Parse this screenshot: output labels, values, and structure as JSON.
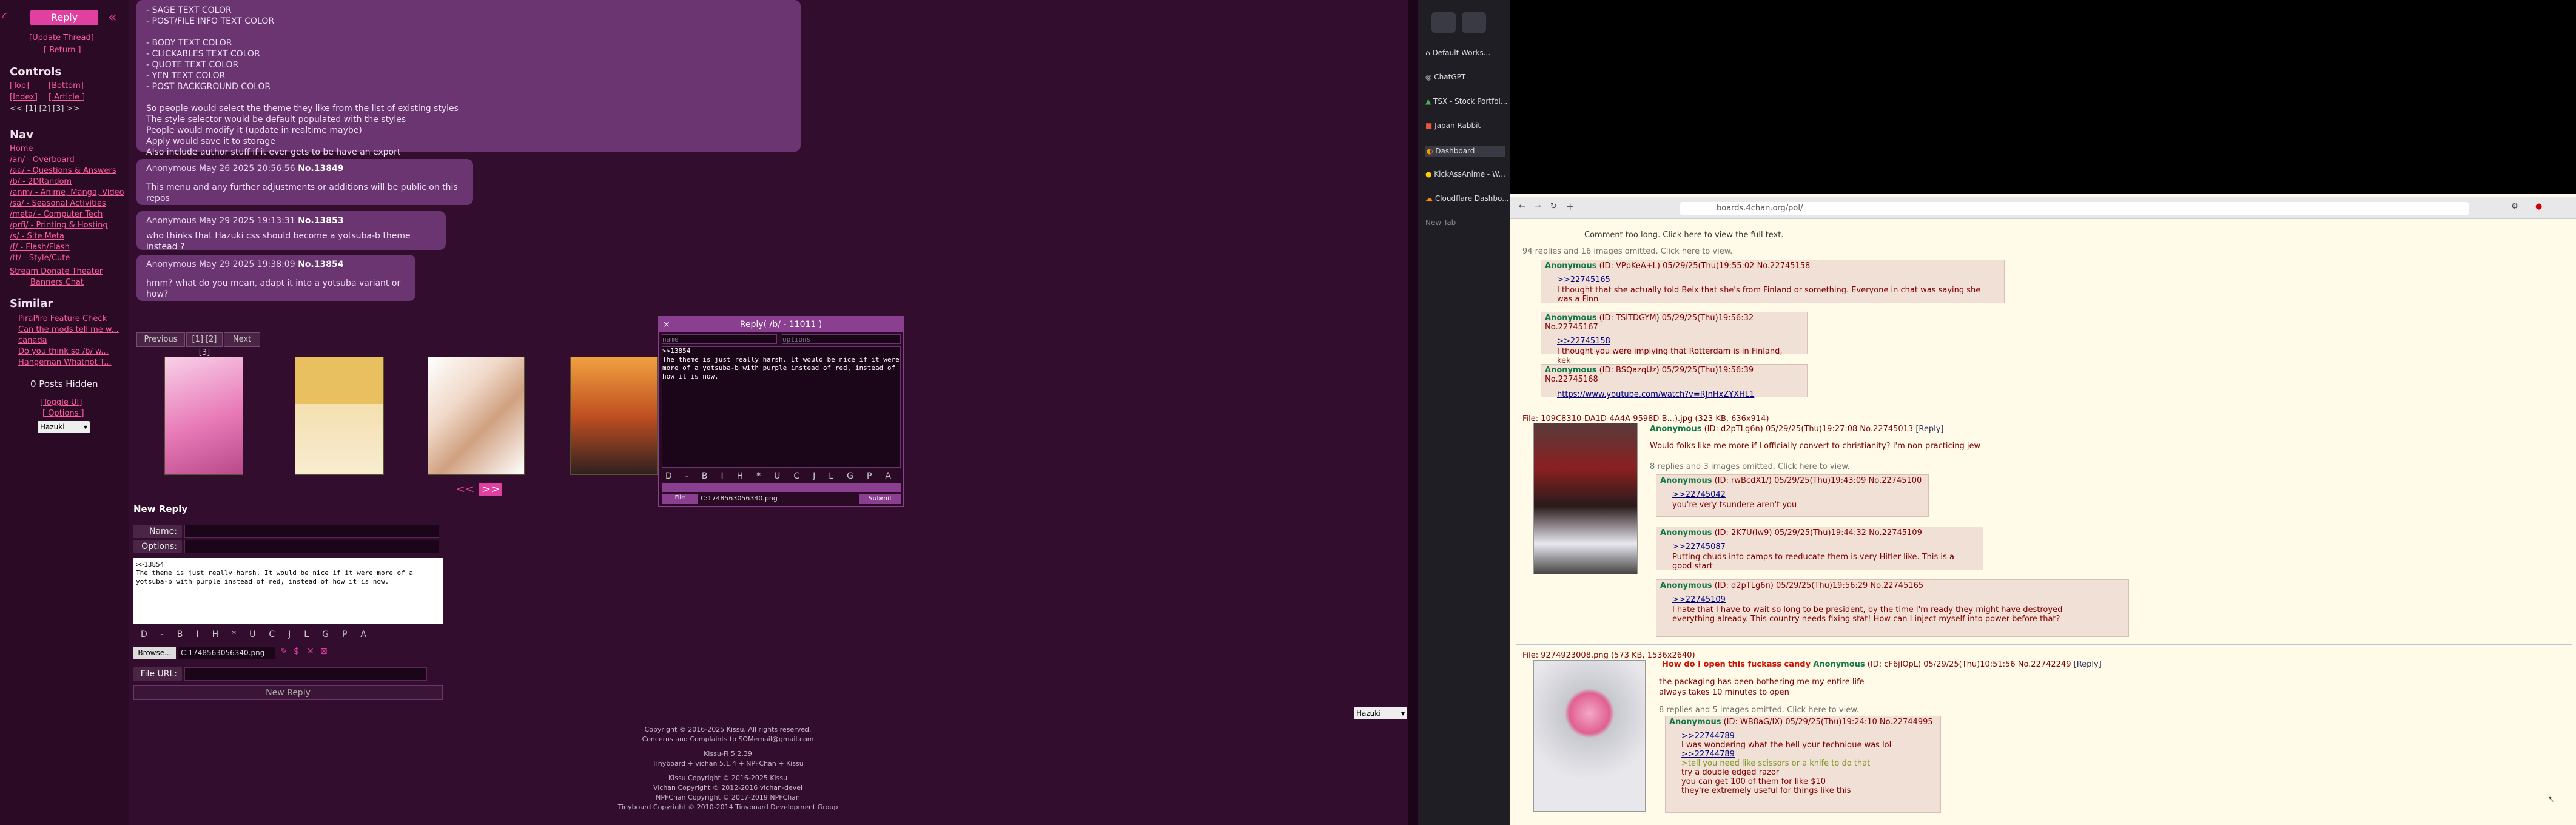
{
  "sidebar": {
    "reply_label": "Reply",
    "top_links": [
      "[Update Thread]",
      "[ Return ]"
    ],
    "controls_title": "Controls",
    "controls_links": [
      "[Top]",
      "[Bottom]",
      "[Index]",
      "[ Article ]",
      "<< [1] [2] [3] >>"
    ],
    "nav_title": "Nav",
    "nav_links": [
      "Home",
      "/an/ - Overboard",
      "/aa/ - Questions & Answers",
      "/b/ - 2DRandom",
      "/anm/ - Anime, Manga, Video",
      "/sa/ - Seasonal Activities",
      "/meta/ - Computer Tech",
      "/prfi/ - Printing & Hosting",
      "/s/ - Site Meta",
      "/f/ - Flash/Flash",
      "/tt/ - Style/Cute",
      "Stream  Donate  Theater",
      "Banners  Chat"
    ],
    "similar_title": "Similar",
    "similar_links": [
      "PiraPiro Feature Check",
      "Can the mods tell me w...",
      "canada",
      "Do you think so /b/ w...",
      "Hangeman Whatnot T..."
    ],
    "hidden_label": "0 Posts Hidden",
    "toggle_links": [
      "[Toggle UI]",
      "[ Options ]"
    ],
    "theme_select": "Hazuki"
  },
  "big_post": {
    "lines": "- SAGE TEXT COLOR\n- POST/FILE INFO TEXT COLOR\n\n- BODY TEXT COLOR\n- CLICKABLES TEXT COLOR\n- QUOTE TEXT COLOR\n- YEN TEXT COLOR\n- POST BACKGROUND COLOR\n\nSo people would select the theme they like from the list of existing styles\nThe style selector would be default populated with the styles\nPeople would modify it (update in realtime maybe)\nApply would save it to storage\nAlso include author stuff if it ever gets to be have an export"
  },
  "posts": [
    {
      "name": "Anonymous",
      "date": "May 26 2025 20:56:56",
      "no": "No.13849",
      "body": "This menu and any further adjustments or additions will be public on this repos"
    },
    {
      "name": "Anonymous",
      "date": "May 29 2025 19:13:31",
      "no": "No.13853",
      "body": "who thinks that Hazuki css should become a yotsuba-b theme instead ?"
    },
    {
      "name": "Anonymous",
      "date": "May 29 2025 19:38:09",
      "no": "No.13854",
      "body": "hmm? what do you mean, adapt it into a yotsuba variant or how?"
    }
  ],
  "pager": {
    "prev": "Previous",
    "pages": "[1] [2] [3]",
    "next": "Next"
  },
  "quick_reply": {
    "title": "Reply( /b/ - 11011 )",
    "name_ph": "name",
    "options_ph": "options",
    "body": ">>13854\nThe theme is just really harsh. It would be nice if it were more of a yotsuba-b with purple instead of red, instead of how it is now.",
    "fmt": [
      "D",
      "-",
      "B",
      "I",
      "H",
      "*",
      "U",
      "C",
      "J",
      "L",
      "G",
      "P",
      "A"
    ],
    "file": "C:1748563056340.png",
    "submit": "Submit"
  },
  "new_reply": {
    "title": "New Reply",
    "name_label": "Name:",
    "options_label": "Options:",
    "body": ">>13854\nThe theme is just really harsh. It would be nice if it were more of a yotsuba-b with purple instead of red, instead of how it is now.",
    "fmt": [
      "D",
      "-",
      "B",
      "I",
      "H",
      "*",
      "U",
      "C",
      "J",
      "L",
      "G",
      "P",
      "A"
    ],
    "browse": "Browse...",
    "file": "C:1748563056340.png",
    "fileurl_label": "File URL:",
    "submit": "New Reply"
  },
  "footer": {
    "lines": [
      "Copyright © 2016-2025 Kissu. All rights reserved.",
      "Concerns and Complaints to SOMemail@gmail.com",
      "",
      "Kissu-Fi 5.2.39",
      "Tinyboard + vichan 5.1.4 + NPFChan + Kissu",
      "",
      "Kissu Copyright © 2016-2025 Kissu",
      "Vichan Copyright © 2012-2016 vichan-devel",
      "NPFChan Copyright © 2017-2019 NPFChan",
      "Tinyboard Copyright © 2010-2014 Tinyboard Development Group"
    ],
    "theme_select": "Hazuki"
  },
  "tabs": [
    "Default Works...",
    "ChatGPT",
    "TSX - Stock Portfol...",
    "Japan Rabbit",
    "Dashboard",
    "KickAssAnime - W...",
    "Cloudflare Dashbo...",
    "New Tab"
  ],
  "browser": {
    "url": "boards.4chan.org/pol/"
  },
  "fc": {
    "top_note": "Comment too long. Click here to view the full text.",
    "omit1": "94 replies and 16 images omitted. Click here to view.",
    "r1": {
      "name": "Anonymous",
      "meta": "(ID: VPpKeA+L) 05/29/25(Thu)19:55:02 No.22745158",
      "q": ">>22745165",
      "text": "I thought that she actually told Beix that she's from Finland or something. Everyone in chat was saying she was a Finn"
    },
    "r2": {
      "name": "Anonymous",
      "meta": "(ID: TSITDGYM) 05/29/25(Thu)19:56:32 No.22745167",
      "q": ">>22745158",
      "text": "I thought you were implying that Rotterdam is in Finland, kek"
    },
    "r3": {
      "name": "Anonymous",
      "meta": "(ID: BSQazqUz) 05/29/25(Thu)19:56:39 No.22745168",
      "text": "https://www.youtube.com/watch?v=RJnHxZYXHL1"
    },
    "file1": "File: 109C8310-DA1D-4A4A-9598D-B...).jpg (323 KB, 636x914)",
    "op1": {
      "name": "Anonymous",
      "meta": "(ID: d2pTLg6n) 05/29/25(Thu)19:27:08 No.22745013",
      "reply": "[Reply]",
      "text": "Would folks like me more if I officially convert to christianity? I'm non-practicing jew"
    },
    "omit2": "8 replies and 3 images omitted. Click here to view.",
    "r4": {
      "name": "Anonymous",
      "meta": "(ID: rwBcdX1/) 05/29/25(Thu)19:43:09 No.22745100",
      "q": ">>22745042",
      "text": "you're very tsundere aren't you"
    },
    "r5": {
      "name": "Anonymous",
      "meta": "(ID: 2K7U(Iw9) 05/29/25(Thu)19:44:32 No.22745109",
      "q": ">>22745087",
      "text": "Putting chuds into camps to reeducate them is very Hitler like. This is a good start"
    },
    "r6": {
      "name": "Anonymous",
      "meta": "(ID: d2pTLg6n) 05/29/25(Thu)19:56:29 No.22745165",
      "q": ">>22745109",
      "text": "I hate that I have to wait so long to be president, by the time I'm ready they might have destroyed everything already. This country needs fixing stat! How can I inject myself into power before that?"
    },
    "file2": "File: 9274923008.png (573 KB, 1536x2640)",
    "op2": {
      "subject": "How do I open this fuckass candy",
      "name": "Anonymous",
      "meta": "(ID: cF6jlOpL) 05/29/25(Thu)10:51:56 No.22742249",
      "reply": "[Reply]",
      "text": "the packaging has been bothering me my entire life\nalways takes 10 minutes to open"
    },
    "omit3": "8 replies and 5 images omitted. Click here to view.",
    "r7": {
      "name": "Anonymous",
      "meta": "(ID: WB8aG/IX) 05/29/25(Thu)19:24:10 No.22744995",
      "q1": ">>22744789",
      "t1": "I was wondering what the hell your technique was lol",
      "q2": ">>22744789",
      "g1": ">tell you need like scissors or a knife to do that",
      "t2": "try a double edged razor\nyou can get 100 of them for like $10\nthey're extremely useful for things like this"
    }
  },
  "colors": {
    "accent": "#e040a0",
    "panel": "#6a3570",
    "bg": "#330d2e",
    "fc_bg": "#fffbe8",
    "fc_post": "#f0e0d6"
  }
}
